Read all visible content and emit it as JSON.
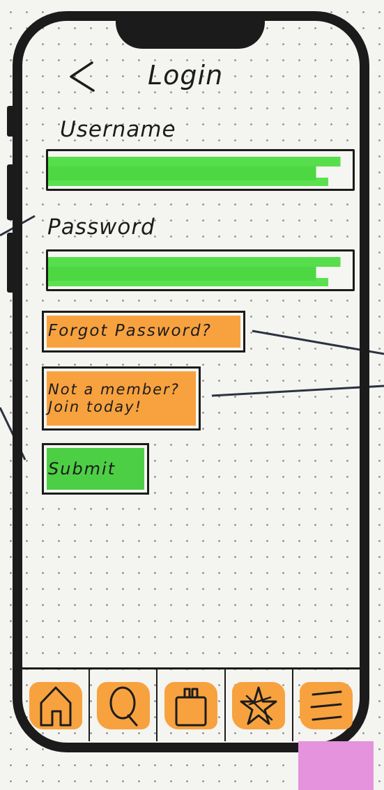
{
  "header": {
    "back_icon": "chevron-left-icon",
    "title": "Login"
  },
  "form": {
    "username_label": "Username",
    "password_label": "Password",
    "forgot_password_label": "Forgot Password?",
    "join_label_line1": "Not a member?",
    "join_label_line2": "Join today!",
    "submit_label": "Submit"
  },
  "bottom_nav": {
    "items": [
      {
        "icon": "home-icon"
      },
      {
        "icon": "search-icon"
      },
      {
        "icon": "bag-icon"
      },
      {
        "icon": "star-icon"
      },
      {
        "icon": "menu-icon"
      }
    ]
  },
  "colors": {
    "field_fill": "#4dd742",
    "button_orange": "#f7a23f",
    "button_green": "#4dcf45",
    "frame": "#1b1b1b",
    "sticky_note": "#e493dc"
  }
}
